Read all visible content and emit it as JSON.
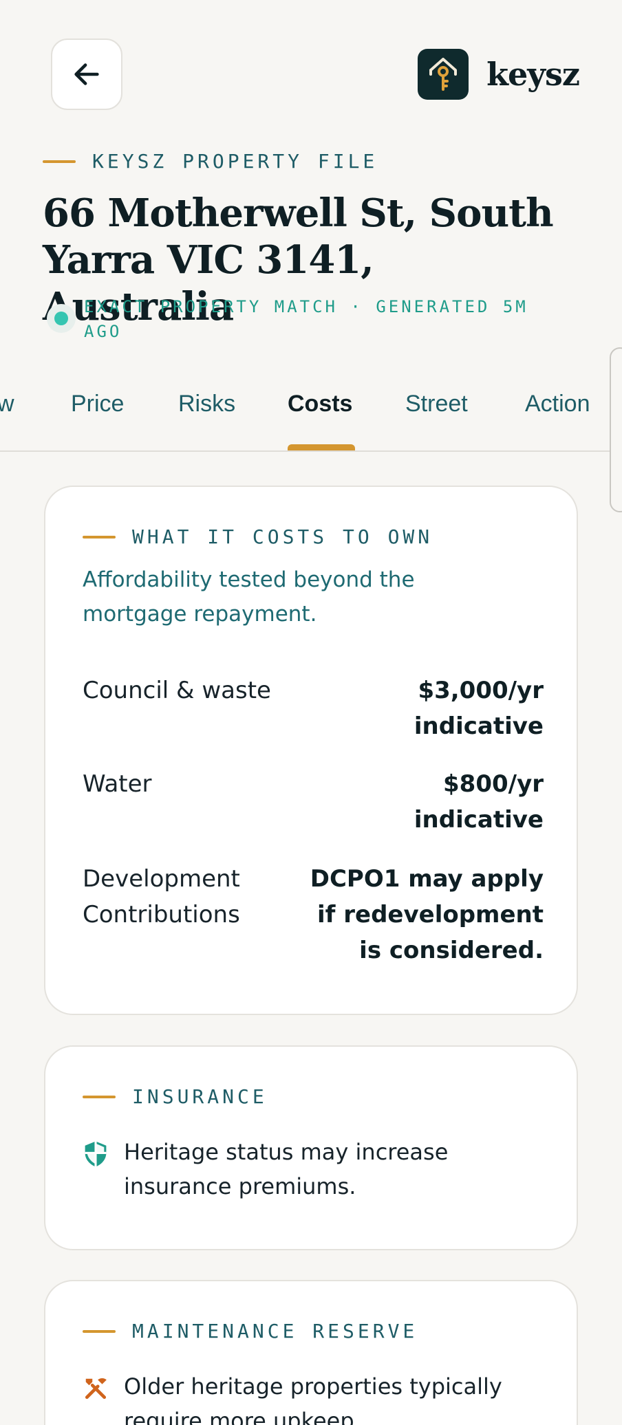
{
  "header": {
    "logo_text": "keysz"
  },
  "file": {
    "eyebrow": "KEYSZ PROPERTY FILE",
    "address": "66 Motherwell St, South Yarra VIC 3141, Australia",
    "match_text": "EXACT PROPERTY MATCH  ·  GENERATED 5M AGO"
  },
  "tabs": [
    {
      "label": "w"
    },
    {
      "label": "Price"
    },
    {
      "label": "Risks"
    },
    {
      "label": "Costs",
      "active": true
    },
    {
      "label": "Street"
    },
    {
      "label": "Action"
    }
  ],
  "costs_card": {
    "eyebrow": "WHAT IT COSTS TO OWN",
    "subtitle": "Affordability tested beyond the mortgage repayment.",
    "rows": [
      {
        "label": "Council & waste",
        "value": "$3,000/yr indicative"
      },
      {
        "label": "Water",
        "value": "$800/yr indicative"
      },
      {
        "label": "Development Contributions",
        "value": "DCPO1 may apply if redevelopment is considered."
      }
    ]
  },
  "insurance_card": {
    "eyebrow": "INSURANCE",
    "icon": "shield-icon",
    "note": "Heritage status may increase insurance premiums."
  },
  "maintenance_card": {
    "eyebrow": "MAINTENANCE RESERVE",
    "icon": "tools-icon",
    "note": "Older heritage properties typically require more upkeep."
  },
  "colors": {
    "accent": "#d4962f",
    "teal": "#1e5c66",
    "match_green": "#35c5b1",
    "brand_dark": "#0f2a2d"
  }
}
